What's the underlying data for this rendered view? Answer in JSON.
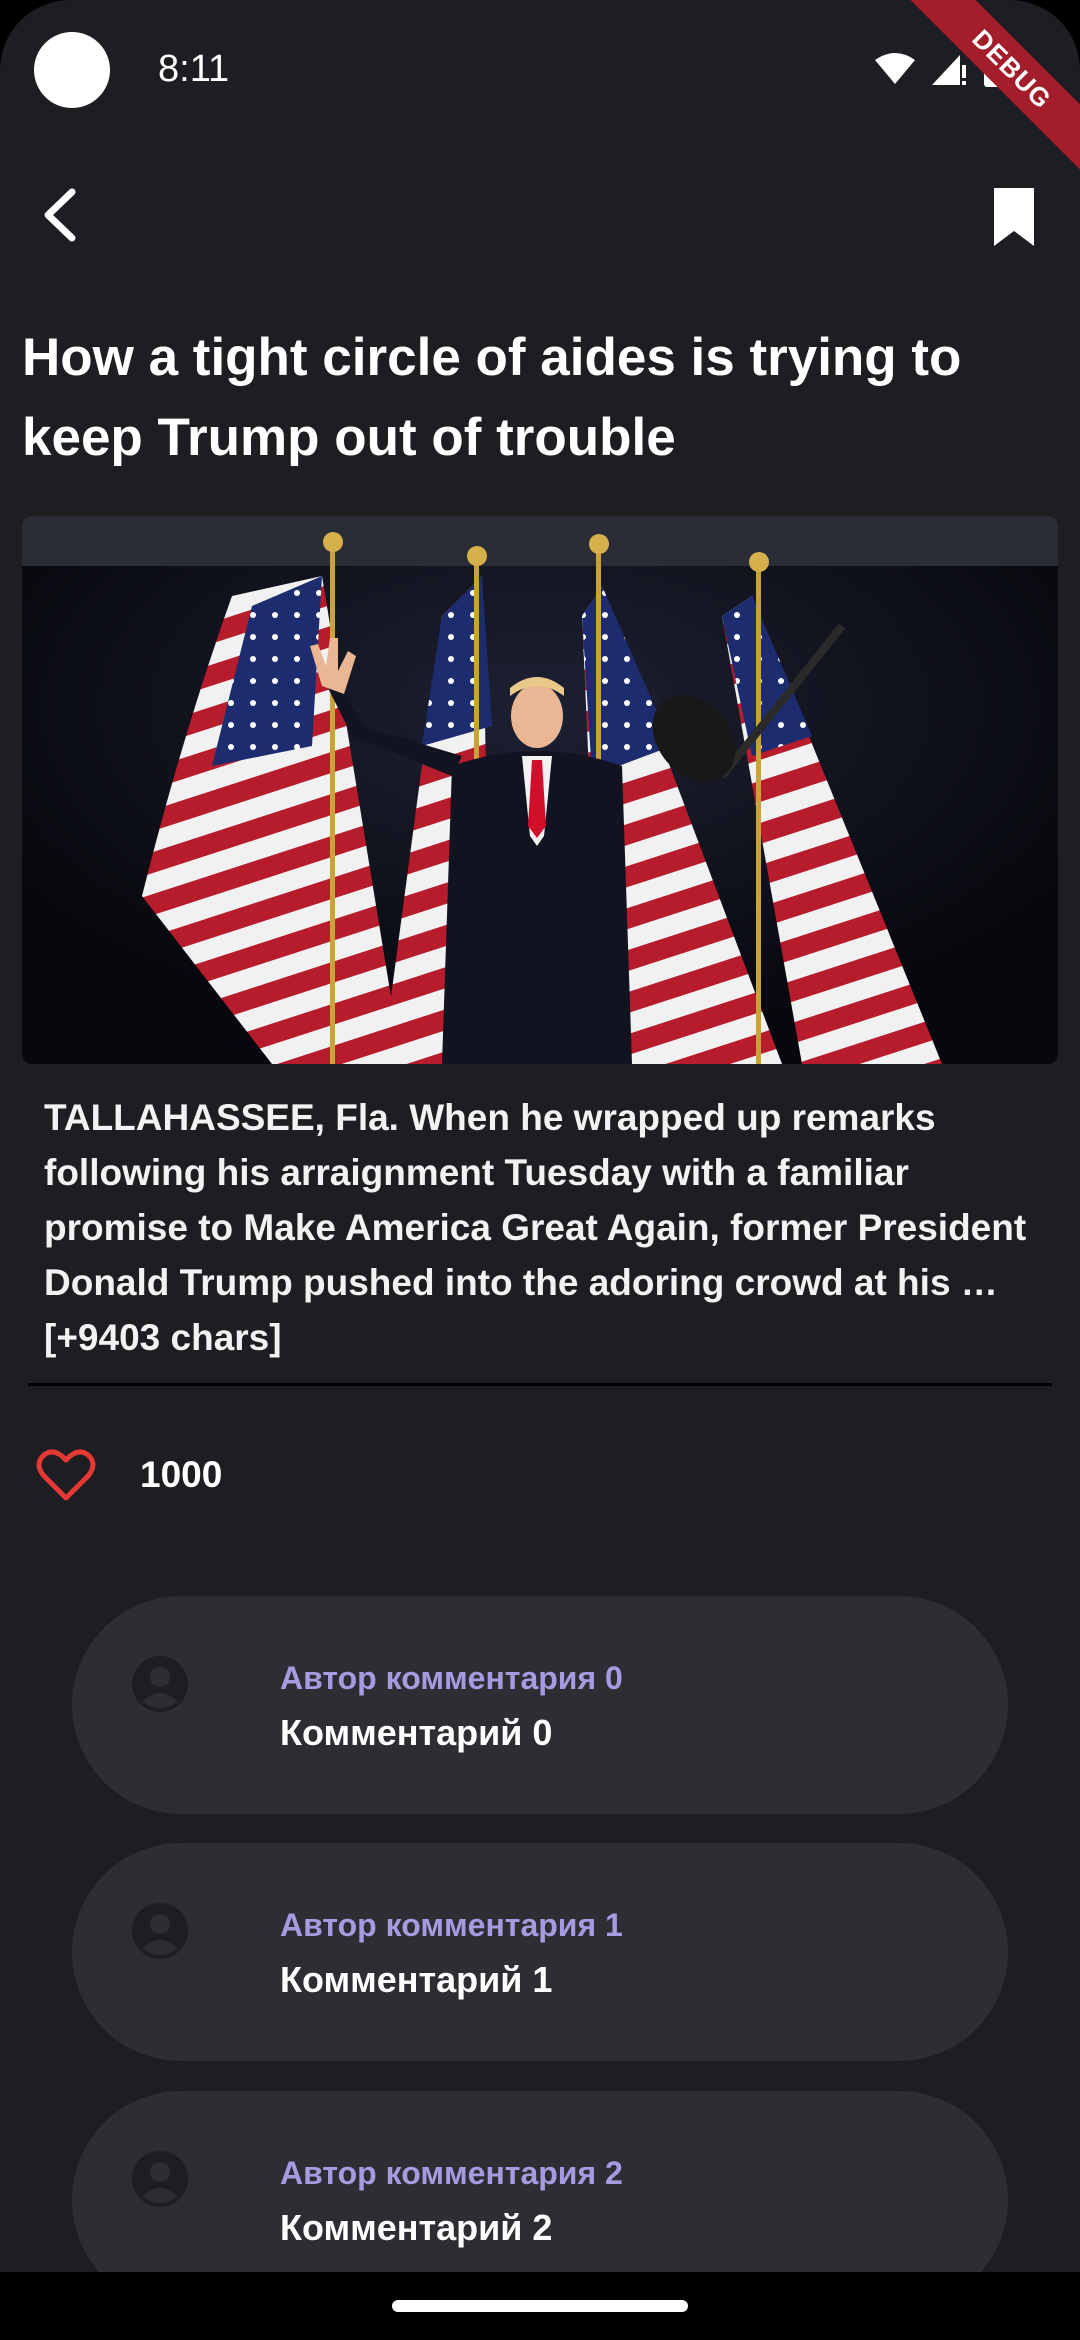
{
  "status_bar": {
    "time": "8:11",
    "debug_label": "DEBUG"
  },
  "article": {
    "title": "How a tight circle of aides is trying to keep Trump out of trouble",
    "body": "TALLAHASSEE, Fla. When he wrapped up remarks following his arraignment Tuesday with a familiar promise to Make America Great Again, former President Donald Trump pushed into the adoring crowd at his … [+9403 chars]",
    "likes": "1000"
  },
  "comments": [
    {
      "author": "Автор комментария 0",
      "text": "Комментарий 0"
    },
    {
      "author": "Автор комментария 1",
      "text": "Комментарий 1"
    },
    {
      "author": "Автор комментария 2",
      "text": "Комментарий 2"
    }
  ],
  "icons": {
    "back": "back-arrow-icon",
    "bookmark": "bookmark-icon",
    "like": "heart-outline-icon",
    "avatar": "person-icon"
  },
  "colors": {
    "accent_like": "#e53935",
    "author": "#a89ae0"
  }
}
